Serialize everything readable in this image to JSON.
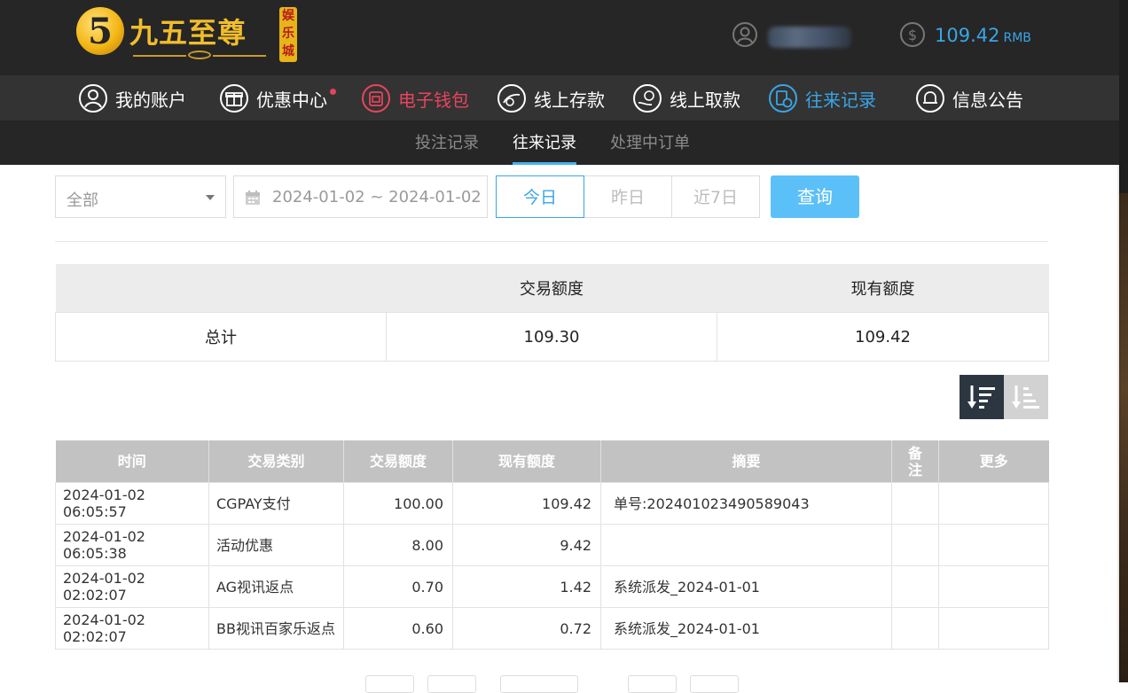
{
  "header": {
    "logo": {
      "badge_char": "5",
      "text": "九五至尊",
      "sub_text": "娱乐城"
    },
    "user": {
      "name": "••••••"
    },
    "balance": {
      "amount": "109.42",
      "unit": "RMB"
    }
  },
  "nav": [
    {
      "label": "我的账户",
      "icon": "user-circle-icon"
    },
    {
      "label": "优惠中心",
      "icon": "gift-icon",
      "dot": true
    },
    {
      "label": "电子钱包",
      "icon": "wallet-icon",
      "state": "highlight-red"
    },
    {
      "label": "线上存款",
      "icon": "deposit-icon"
    },
    {
      "label": "线上取款",
      "icon": "withdraw-icon"
    },
    {
      "label": "往来记录",
      "icon": "records-icon",
      "state": "active"
    },
    {
      "label": "信息公告",
      "icon": "bell-icon"
    }
  ],
  "subnav": [
    {
      "label": "投注记录"
    },
    {
      "label": "往来记录",
      "active": true
    },
    {
      "label": "处理中订单"
    }
  ],
  "filters": {
    "type": "全部",
    "date_range": "2024-01-02 ~ 2024-01-02",
    "ranges": [
      "今日",
      "昨日",
      "近7日"
    ],
    "active_range": "今日",
    "query_label": "查询"
  },
  "summary": {
    "headers": [
      "",
      "交易额度",
      "现有额度"
    ],
    "row": {
      "label": "总计",
      "transaction": "109.30",
      "current": "109.42"
    }
  },
  "table": {
    "headers": [
      "时间",
      "交易类别",
      "交易额度",
      "现有额度",
      "摘要",
      "备注",
      "更多"
    ],
    "rows": [
      {
        "time": "2024-01-02 06:05:57",
        "type": "CGPAY支付",
        "amount": "100.00",
        "balance": "109.42",
        "summary": "单号:202401023490589043",
        "note": "",
        "more": ""
      },
      {
        "time": "2024-01-02 06:05:38",
        "type": "活动优惠",
        "amount": "8.00",
        "balance": "9.42",
        "summary": "",
        "note": "",
        "more": ""
      },
      {
        "time": "2024-01-02 02:02:07",
        "type": "AG视讯返点",
        "amount": "0.70",
        "balance": "1.42",
        "summary": "系统派发_2024-01-01",
        "note": "",
        "more": ""
      },
      {
        "time": "2024-01-02 02:02:07",
        "type": "BB视讯百家乐返点",
        "amount": "0.60",
        "balance": "0.72",
        "summary": "系统派发_2024-01-01",
        "note": "",
        "more": ""
      }
    ]
  },
  "colors": {
    "accent": "#3aa5e6",
    "alert": "#e8445f",
    "header_bg": "#262626",
    "nav_bg": "#333333"
  }
}
